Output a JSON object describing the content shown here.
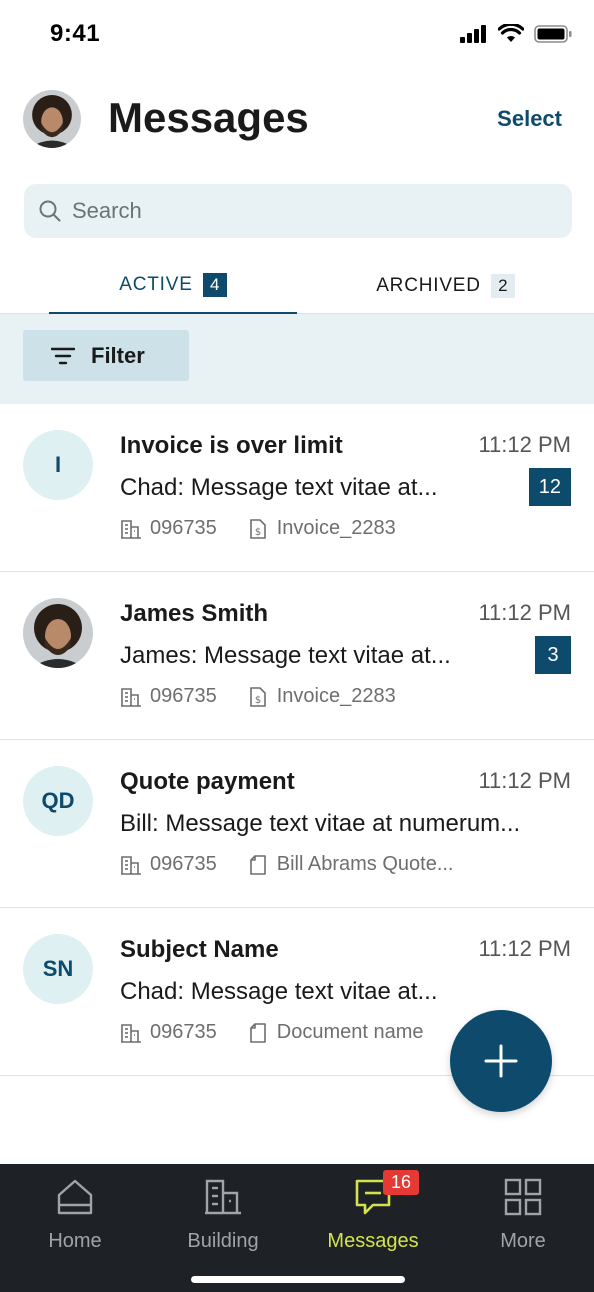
{
  "status_bar": {
    "time": "9:41"
  },
  "header": {
    "title": "Messages",
    "select_label": "Select"
  },
  "search": {
    "placeholder": "Search",
    "value": ""
  },
  "tabs": [
    {
      "label": "ACTIVE",
      "count": "4",
      "selected": true
    },
    {
      "label": "ARCHIVED",
      "count": "2",
      "selected": false
    }
  ],
  "filter": {
    "label": "Filter"
  },
  "messages": [
    {
      "avatar_initials": "I",
      "subject": "Invoice is over limit",
      "time": "11:12 PM",
      "preview": "Chad: Message text vitae at...",
      "unread_count": "12",
      "building_id": "096735",
      "attachment": "Invoice_2283",
      "attachment_icon": "invoice-icon"
    },
    {
      "avatar_initials": "",
      "avatar_photo": true,
      "subject": "James Smith",
      "time": "11:12 PM",
      "preview": "James: Message text vitae at...",
      "unread_count": "3",
      "building_id": "096735",
      "attachment": "Invoice_2283",
      "attachment_icon": "invoice-icon"
    },
    {
      "avatar_initials": "QD",
      "subject": "Quote payment",
      "time": "11:12 PM",
      "preview": "Bill: Message text vitae at numerum...",
      "unread_count": "",
      "building_id": "096735",
      "attachment": "Bill Abrams Quote...",
      "attachment_icon": "document-icon"
    },
    {
      "avatar_initials": "SN",
      "subject": "Subject Name",
      "time": "11:12 PM",
      "preview": "Chad: Message text vitae at...",
      "unread_count": "",
      "building_id": "096735",
      "attachment": "Document name",
      "attachment_icon": "document-icon"
    }
  ],
  "bottom_nav": [
    {
      "label": "Home",
      "icon": "home-icon"
    },
    {
      "label": "Building",
      "icon": "building-icon"
    },
    {
      "label": "Messages",
      "icon": "messages-icon",
      "badge": "16",
      "selected": true
    },
    {
      "label": "More",
      "icon": "grid-icon"
    }
  ],
  "colors": {
    "primary": "#0d4a6b",
    "accent_nav": "#d4e34b",
    "badge_red": "#e53935",
    "nav_background": "#1e2226",
    "surface_tint": "#e8f2f5"
  }
}
